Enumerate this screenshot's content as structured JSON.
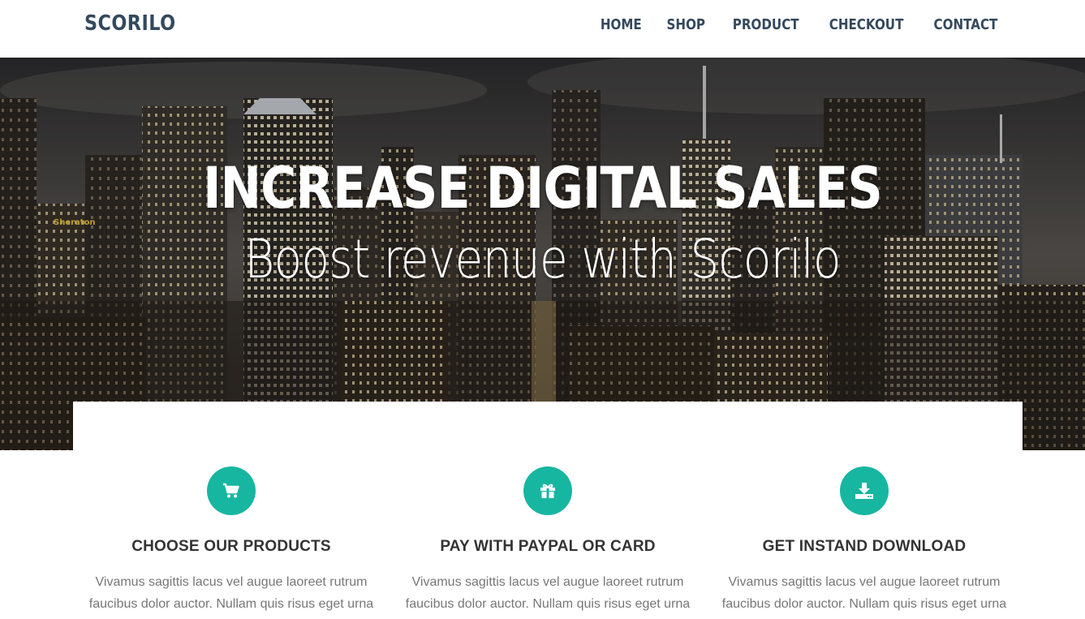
{
  "brand": "SCORILO",
  "nav": [
    {
      "label": "HOME"
    },
    {
      "label": "SHOP"
    },
    {
      "label": "PRODUCT"
    },
    {
      "label": "CHECKOUT"
    },
    {
      "label": "CONTACT"
    }
  ],
  "hero": {
    "title": "INCREASE DIGITAL SALES",
    "subtitle": "Boost revenue with Scorilo",
    "sign_text": "Sheraton"
  },
  "colors": {
    "brand_text": "#34495e",
    "accent": "#17b6a1"
  },
  "features": [
    {
      "icon": "cart-icon",
      "title": "CHOOSE OUR PRODUCTS",
      "text": "Vivamus sagittis lacus vel augue laoreet rutrum faucibus dolor auctor. Nullam quis risus eget urna"
    },
    {
      "icon": "gift-icon",
      "title": "PAY WITH PAYPAL OR CARD",
      "text": "Vivamus sagittis lacus vel augue laoreet rutrum faucibus dolor auctor. Nullam quis risus eget urna"
    },
    {
      "icon": "download-icon",
      "title": "GET INSTAND DOWNLOAD",
      "text": "Vivamus sagittis lacus vel augue laoreet rutrum faucibus dolor auctor. Nullam quis risus eget urna"
    }
  ]
}
